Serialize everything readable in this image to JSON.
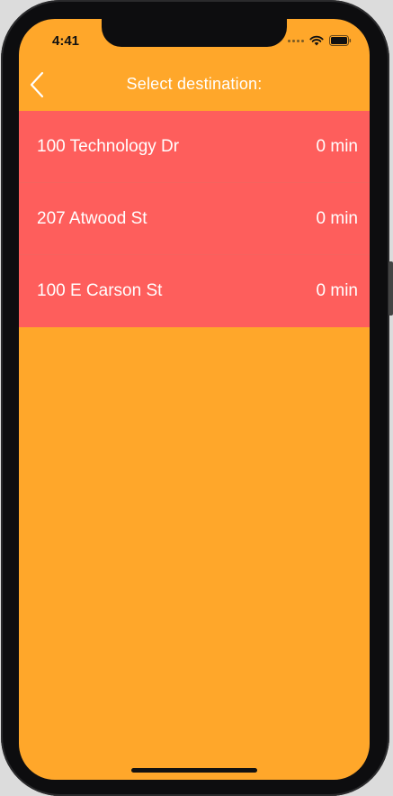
{
  "status_bar": {
    "time": "4:41"
  },
  "nav": {
    "title": "Select destination:",
    "back_icon": "chevron-left-icon"
  },
  "destinations": [
    {
      "name": "100 Technology Dr",
      "eta": "0 min"
    },
    {
      "name": "207 Atwood St",
      "eta": "0 min"
    },
    {
      "name": "100 E Carson St",
      "eta": "0 min"
    }
  ],
  "colors": {
    "background": "#FFA72A",
    "list_background": "#FE5E5C",
    "text": "#FFFFFF"
  }
}
